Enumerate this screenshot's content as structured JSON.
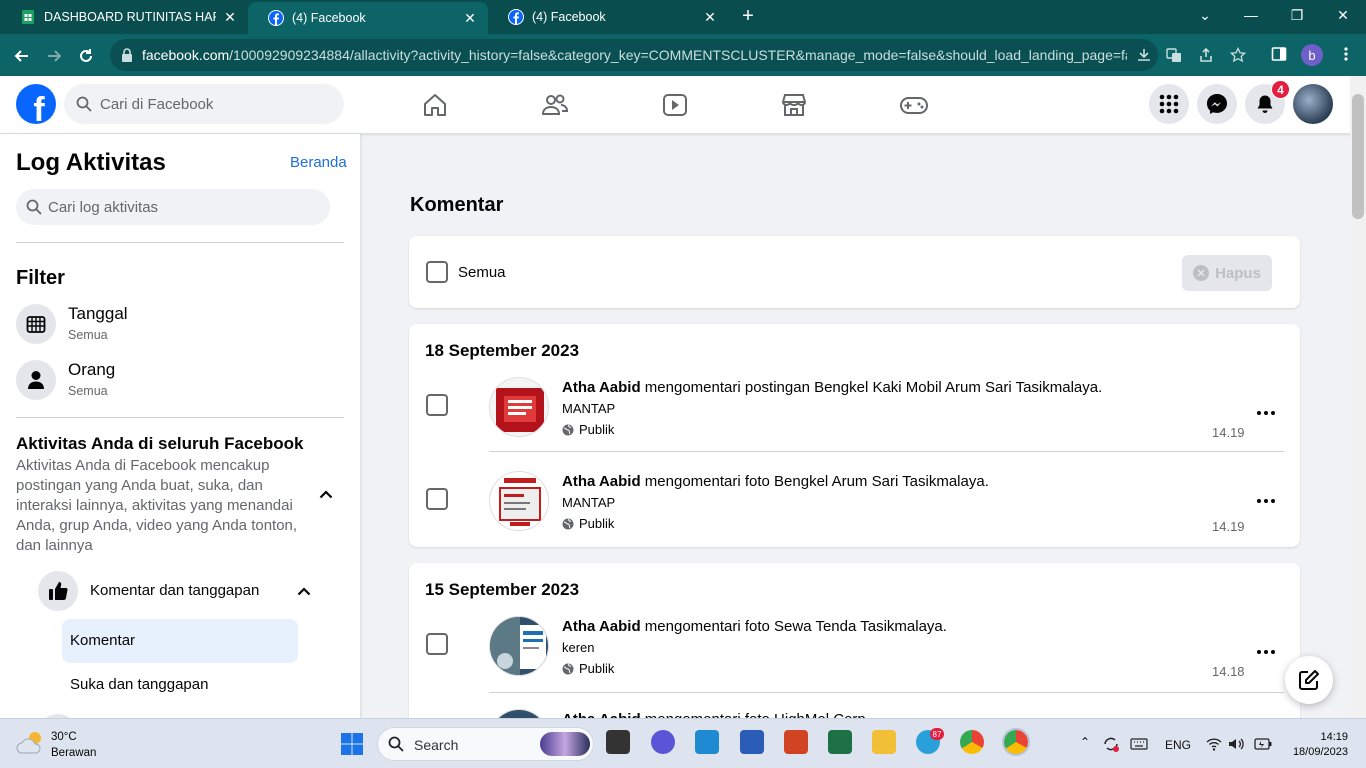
{
  "browser": {
    "tabs": [
      {
        "title": "DASHBOARD RUTINITAS HARIAN",
        "favicon": "sheets-icon"
      },
      {
        "title": "(4) Facebook",
        "favicon": "facebook-icon"
      },
      {
        "title": "(4) Facebook",
        "favicon": "facebook-icon"
      }
    ],
    "url_host": "facebook.com",
    "url_rest": "/100092909234884/allactivity?activity_history=false&category_key=COMMENTSCLUSTER&manage_mode=false&should_load_landing_page=fa...",
    "profile_initial": "b"
  },
  "fb_header": {
    "logo": "f",
    "search_placeholder": "Cari di Facebook",
    "notification_count": "4"
  },
  "sidebar": {
    "title": "Log Aktivitas",
    "home_link": "Beranda",
    "search_placeholder": "Cari log aktivitas",
    "filter_heading": "Filter",
    "filters": [
      {
        "label": "Tanggal",
        "value": "Semua",
        "icon": "calendar-icon"
      },
      {
        "label": "Orang",
        "value": "Semua",
        "icon": "person-icon"
      }
    ],
    "activity_heading": "Aktivitas Anda di seluruh Facebook",
    "activity_desc": "Aktivitas Anda di Facebook mencakup postingan yang Anda buat, suka, dan interaksi lainnya, aktivitas yang menandai Anda, grup Anda, video yang Anda tonton, dan lainnya",
    "category": {
      "label": "Komentar dan tanggapan",
      "icon": "thumbs-up-icon"
    },
    "subitems": [
      "Komentar",
      "Suka dan tanggapan"
    ]
  },
  "main": {
    "title": "Komentar",
    "select_all": "Semua",
    "delete_label": "Hapus",
    "groups": [
      {
        "date": "18 September 2023",
        "entries": [
          {
            "actor": "Atha Aabid",
            "verb": "mengomentari",
            "object": "postingan Bengkel Kaki Mobil Arum Sari Tasikmalaya.",
            "comment": "MANTAP",
            "privacy": "Publik",
            "time": "14.19"
          },
          {
            "actor": "Atha Aabid",
            "verb": "mengomentari",
            "object": "foto Bengkel Arum Sari Tasikmalaya.",
            "comment": "MANTAP",
            "privacy": "Publik",
            "time": "14.19"
          }
        ]
      },
      {
        "date": "15 September 2023",
        "entries": [
          {
            "actor": "Atha Aabid",
            "verb": "mengomentari",
            "object": "foto Sewa Tenda Tasikmalaya.",
            "comment": "keren",
            "privacy": "Publik",
            "time": "14.18"
          },
          {
            "actor": "Atha Aabid",
            "verb": "mengomentari",
            "object": "foto HighMel Corp.",
            "comment": "",
            "privacy": "",
            "time": ""
          }
        ]
      }
    ]
  },
  "taskbar": {
    "temp": "30°C",
    "weather": "Berawan",
    "search_label": "Search",
    "lang": "ENG",
    "time": "14:19",
    "date": "18/09/2023",
    "telegram_badge": "87"
  },
  "colors": {
    "fb_blue": "#0866ff",
    "chrome_bg": "#0a4d4f",
    "link": "#216fdb"
  }
}
